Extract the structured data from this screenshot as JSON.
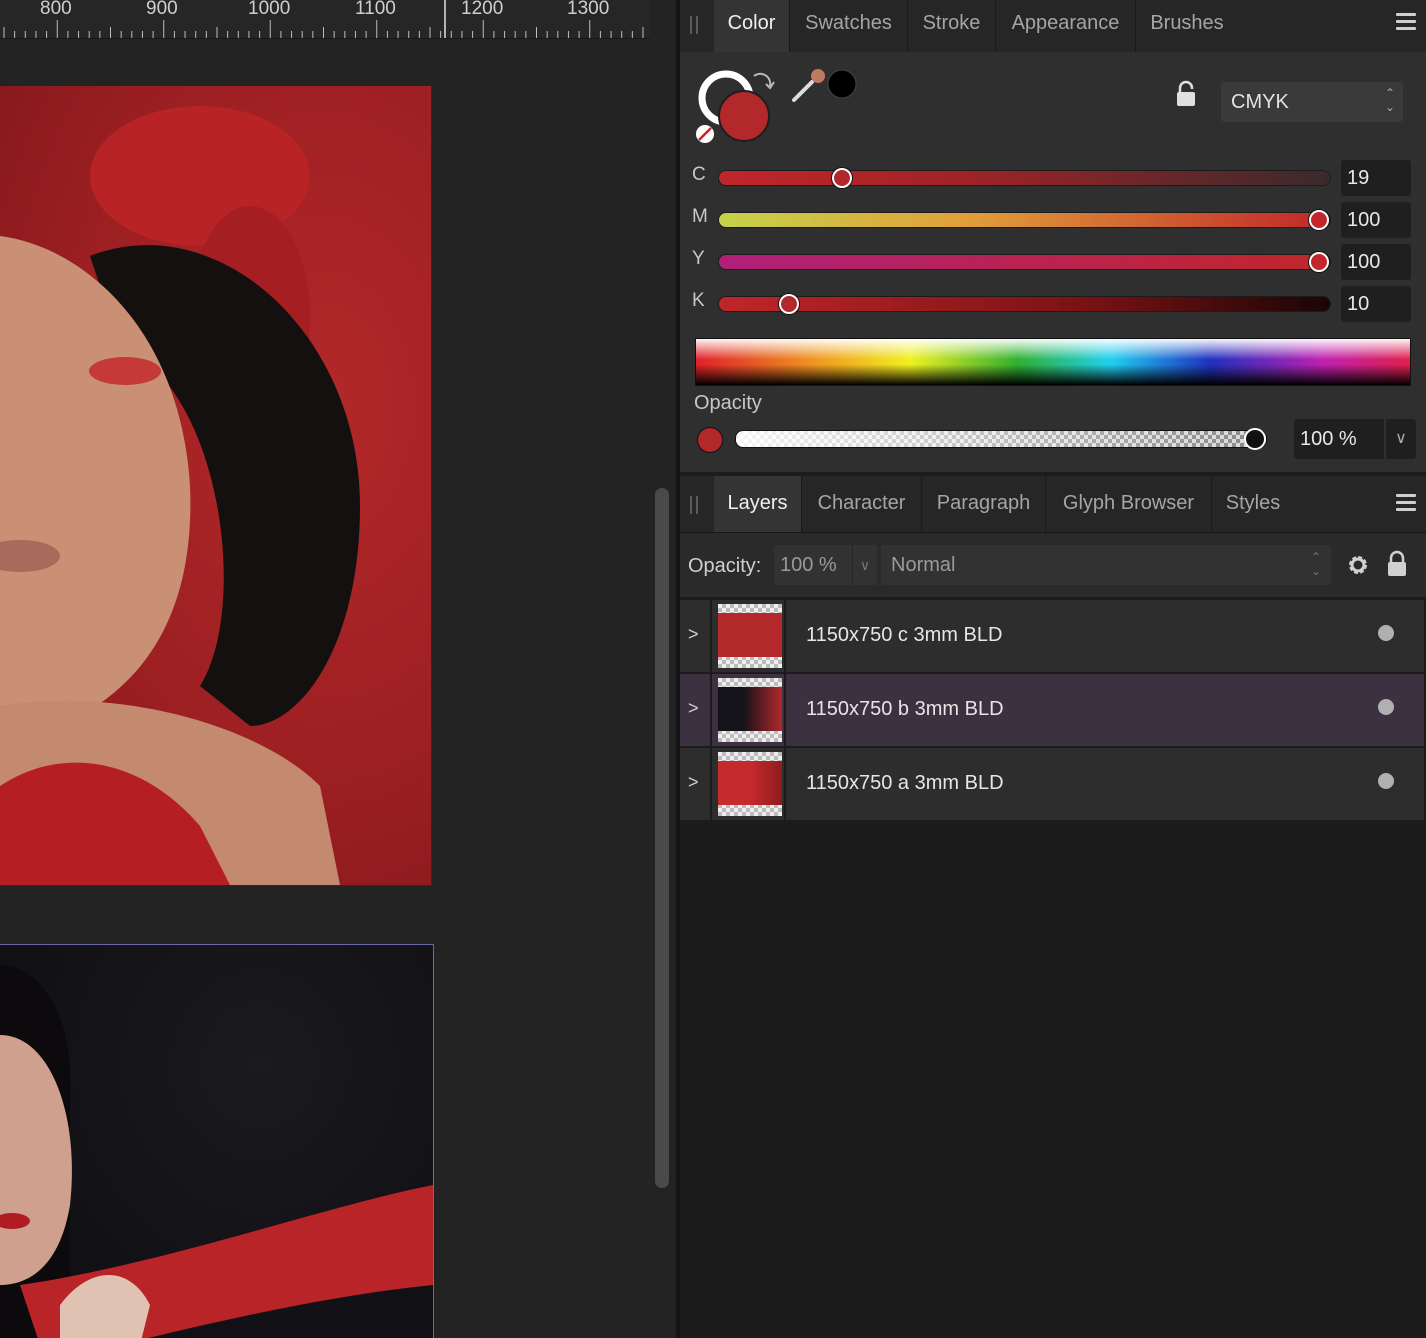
{
  "ruler": {
    "labels": [
      "800",
      "900",
      "1000",
      "1100",
      "1200",
      "1300"
    ]
  },
  "color_panel": {
    "tabs": [
      {
        "label": "Color",
        "active": true
      },
      {
        "label": "Swatches",
        "active": false
      },
      {
        "label": "Stroke",
        "active": false
      },
      {
        "label": "Appearance",
        "active": false
      },
      {
        "label": "Brushes",
        "active": false
      }
    ],
    "fill_color": "#b3282a",
    "eyedropper_color": "#000000",
    "color_model": "CMYK",
    "sliders": [
      {
        "letter": "C",
        "value": "19",
        "fraction": 0.19,
        "gradient": "linear-gradient(to right, #c0262a, #a02327 40%, #3a2a2c)"
      },
      {
        "letter": "M",
        "value": "100",
        "fraction": 1.0,
        "gradient": "linear-gradient(to right, #c6d24a, #e0a03a 40%, #c0262a)"
      },
      {
        "letter": "Y",
        "value": "100",
        "fraction": 1.0,
        "gradient": "linear-gradient(to right, #b0207a, #c0262a)"
      },
      {
        "letter": "K",
        "value": "10",
        "fraction": 0.1,
        "gradient": "linear-gradient(to right, #c0262a, #7a1214 60%, #1a0505)"
      }
    ],
    "opacity_label": "Opacity",
    "opacity_value": "100 %",
    "opacity_fraction": 1.0
  },
  "layers_panel": {
    "tabs": [
      {
        "label": "Layers",
        "active": true
      },
      {
        "label": "Character",
        "active": false
      },
      {
        "label": "Paragraph",
        "active": false
      },
      {
        "label": "Glyph Browser",
        "active": false
      },
      {
        "label": "Styles",
        "active": false
      }
    ],
    "opacity_label": "Opacity:",
    "opacity_value": "100 %",
    "blend_mode": "Normal",
    "layers": [
      {
        "name": "1150x750 c 3mm BLD",
        "selected": false
      },
      {
        "name": "1150x750 b 3mm BLD",
        "selected": true
      },
      {
        "name": "1150x750 a 3mm BLD",
        "selected": false
      }
    ]
  }
}
